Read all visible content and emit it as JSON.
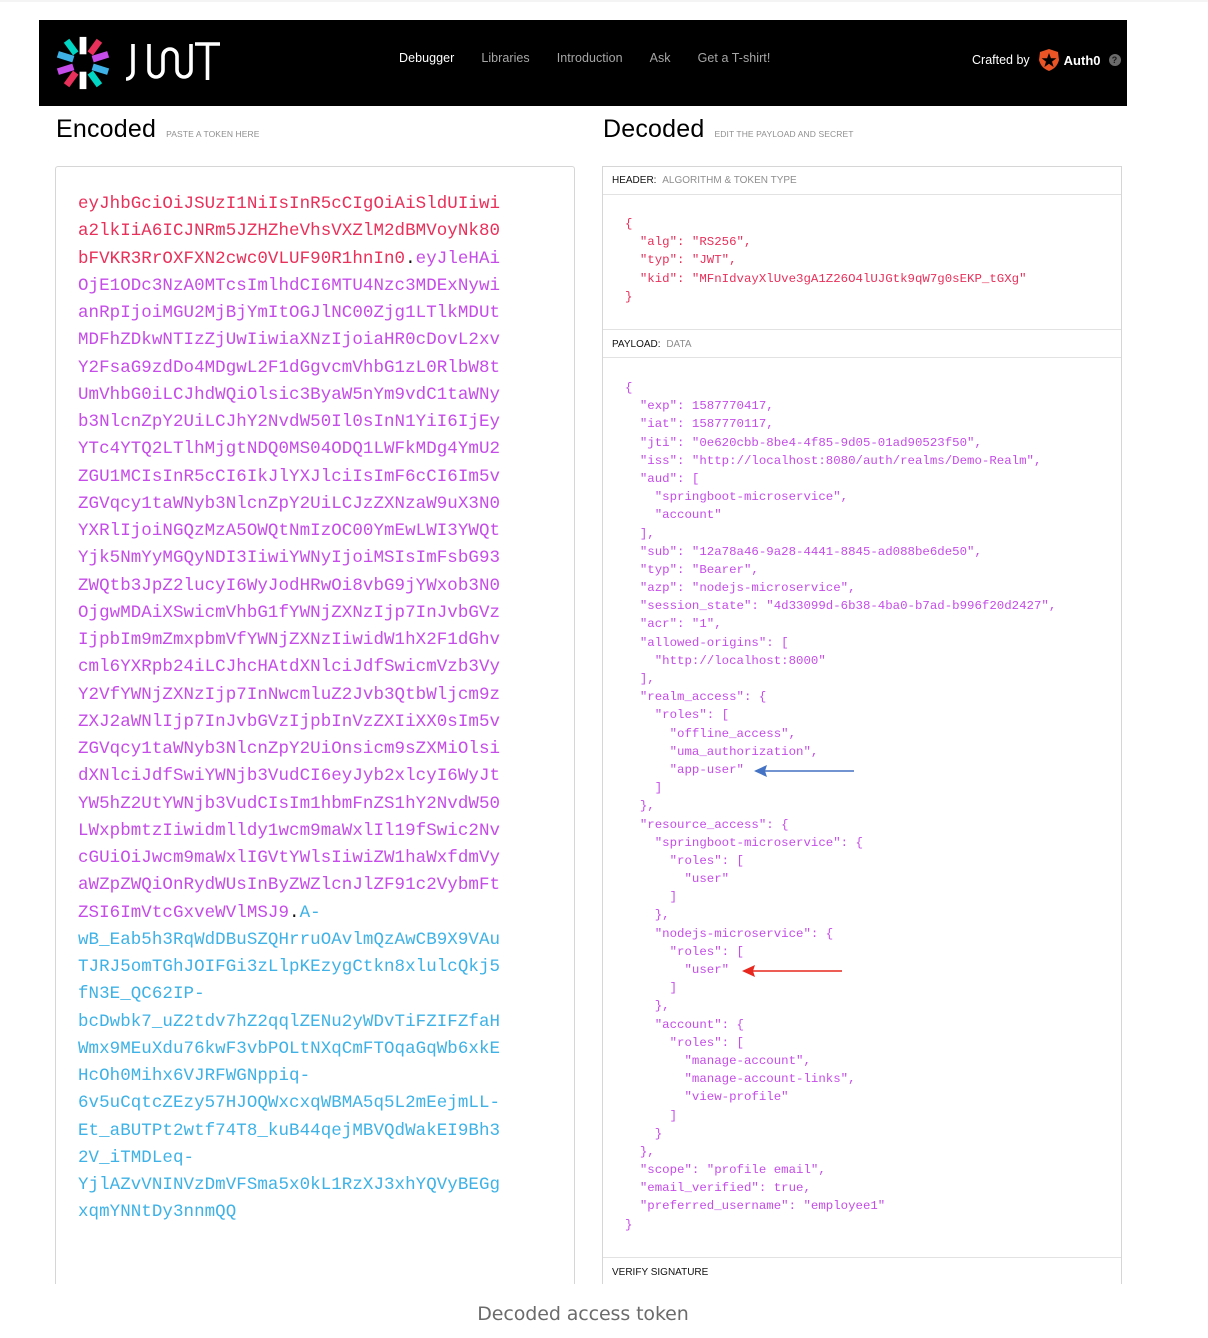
{
  "navbar": {
    "brand": "JWT",
    "links": [
      {
        "label": "Debugger",
        "active": true
      },
      {
        "label": "Libraries",
        "active": false
      },
      {
        "label": "Introduction",
        "active": false
      },
      {
        "label": "Ask",
        "active": false
      },
      {
        "label": "Get a T-shirt!",
        "active": false
      }
    ],
    "crafted_by_label": "Crafted by",
    "partner_label": "Auth0",
    "partner_icon": "auth0-shield-star-icon",
    "help_icon": "question-mark-circle-icon",
    "help_glyph": "?"
  },
  "encoded": {
    "title": "Encoded",
    "subtitle": "PASTE A TOKEN HERE",
    "separator": ".",
    "header_lines": [
      "eyJhbGciOiJSUzI1NiIsInR5cCIgOiAiSldUIiwi",
      "a2lkIiA6ICJNRm5JZHZheVhsVXZlM2dBMVoyNk80",
      "bFVKR3RrOXFXN2cwc0VLUF90R1hnIn0"
    ],
    "payload_first": "eyJleHAi",
    "payload_lines": [
      "OjE1ODc3NzA0MTcsImlhdCI6MTU4Nzc3MDExNywi",
      "anRpIjoiMGU2MjBjYmItOGJlNC00Zjg1LTlkMDUt",
      "MDFhZDkwNTIzZjUwIiwiaXNzIjoiaHR0cDovL2xv",
      "Y2FsaG9zdDo4MDgwL2F1dGgvcmVhbG1zL0RlbW8t",
      "UmVhbG0iLCJhdWQiOlsic3ByaW5nYm9vdC1taWNy",
      "b3NlcnZpY2UiLCJhY2NvdW50Il0sInN1YiI6IjEy",
      "YTc4YTQ2LTlhMjgtNDQ0MS04ODQ1LWFkMDg4YmU2",
      "ZGU1MCIsInR5cCI6IkJlYXJlciIsImF6cCI6Im5v",
      "ZGVqcy1taWNyb3NlcnZpY2UiLCJzZXNzaW9uX3N0",
      "YXRlIjoiNGQzMzA5OWQtNmIzOC00YmEwLWI3YWQt",
      "Yjk5NmYyMGQyNDI3IiwiYWNyIjoiMSIsImFsbG93",
      "ZWQtb3JpZ2lucyI6WyJodHRwOi8vbG9jYWxob3N0",
      "OjgwMDAiXSwicmVhbG1fYWNjZXNzIjp7InJvbGVz",
      "IjpbIm9mZmxpbmVfYWNjZXNzIiwidW1hX2F1dGhv",
      "cml6YXRpb24iLCJhcHAtdXNlciJdfSwicmVzb3Vy",
      "Y2VfYWNjZXNzIjp7InNwcmluZ2Jvb3QtbWljcm9z",
      "ZXJ2aWNlIjp7InJvbGVzIjpbInVzZXIiXX0sIm5v",
      "ZGVqcy1taWNyb3NlcnZpY2UiOnsicm9sZXMiOlsi",
      "dXNlciJdfSwiYWNjb3VudCI6eyJyb2xlcyI6WyJt",
      "YW5hZ2UtYWNjb3VudCIsIm1hbmFnZS1hY2NvdW50",
      "LWxpbmtzIiwidmlldy1wcm9maWxlIl19fSwic2Nv",
      "cGUiOiJwcm9maWxlIGVtYWlsIiwiZW1haWxfdmVy",
      "aWZpZWQiOnRydWUsInByZWZlcnJlZF91c2VybmFt",
      "ZSI6ImVtcGxveWVlMSJ9"
    ],
    "signature_first": "A-",
    "signature_lines": [
      "wB_Eab5h3RqWdDBuSZQHrruOAvlmQzAwCB9X9VAu",
      "TJRJ5omTGhJOIFGi3zLlpKEzygCtkn8xlulcQkj5",
      "fN3E_QC62IP-",
      "bcDwbk7_uZ2tdv7hZ2qqlZENu2yWDvTiFZIFZfaH",
      "Wmx9MEuXdu76kwF3vbPOLtNXqCmFTOqaGqWb6xkE",
      "HcOh0Mihx6VJRFWGNppiq-",
      "6v5uCqtcZEzy57HJOQWxcxqWBMA5q5L2mEejmLL-",
      "Et_aBUTPt2wtf74T8_kuB44qejMBVQdWakEI9Bh3",
      "2V_iTMDLeq-",
      "YjlAZvVNINVzDmVFSma5x0kL1RzXJ3xhYQVyBEGg",
      "xqmYNNtDy3nnmQQ"
    ]
  },
  "decoded": {
    "title": "Decoded",
    "subtitle": "EDIT THE PAYLOAD AND SECRET",
    "header_panel": {
      "label": "HEADER:",
      "sublabel": "ALGORITHM & TOKEN TYPE",
      "lines": [
        "{",
        "  \"alg\": \"RS256\",",
        "  \"typ\": \"JWT\",",
        "  \"kid\": \"MFnIdvayXlUve3gA1Z26O4lUJGtk9qW7g0sEKP_tGXg\"",
        "}"
      ]
    },
    "payload_panel": {
      "label": "PAYLOAD:",
      "sublabel": "DATA",
      "lines": [
        "{",
        "  \"exp\": 1587770417,",
        "  \"iat\": 1587770117,",
        "  \"jti\": \"0e620cbb-8be4-4f85-9d05-01ad90523f50\",",
        "  \"iss\": \"http://localhost:8080/auth/realms/Demo-Realm\",",
        "  \"aud\": [",
        "    \"springboot-microservice\",",
        "    \"account\"",
        "  ],",
        "  \"sub\": \"12a78a46-9a28-4441-8845-ad088be6de50\",",
        "  \"typ\": \"Bearer\",",
        "  \"azp\": \"nodejs-microservice\",",
        "  \"session_state\": \"4d33099d-6b38-4ba0-b7ad-b996f20d2427\",",
        "  \"acr\": \"1\",",
        "  \"allowed-origins\": [",
        "    \"http://localhost:8000\"",
        "  ],",
        "  \"realm_access\": {",
        "    \"roles\": [",
        "      \"offline_access\",",
        "      \"uma_authorization\",",
        "      \"app-user\"",
        "    ]",
        "  },",
        "  \"resource_access\": {",
        "    \"springboot-microservice\": {",
        "      \"roles\": [",
        "        \"user\"",
        "      ]",
        "    },",
        "    \"nodejs-microservice\": {",
        "      \"roles\": [",
        "        \"user\"",
        "      ]",
        "    },",
        "    \"account\": {",
        "      \"roles\": [",
        "        \"manage-account\",",
        "        \"manage-account-links\",",
        "        \"view-profile\"",
        "      ]",
        "    }",
        "  },",
        "  \"scope\": \"profile email\",",
        "  \"email_verified\": true,",
        "  \"preferred_username\": \"employee1\"",
        "}"
      ]
    },
    "verify_panel": {
      "label": "VERIFY SIGNATURE"
    }
  },
  "annotations": {
    "realm_role_arrow": {
      "points_to": "app-user",
      "color": "#4472c4"
    },
    "client_role_arrow": {
      "points_to": "user (nodejs-microservice)",
      "color": "#e8271f"
    }
  },
  "colors": {
    "header": "#e8305a",
    "payload": "#c54ce8",
    "signature": "#3eb2e6"
  },
  "caption": "Decoded access token"
}
